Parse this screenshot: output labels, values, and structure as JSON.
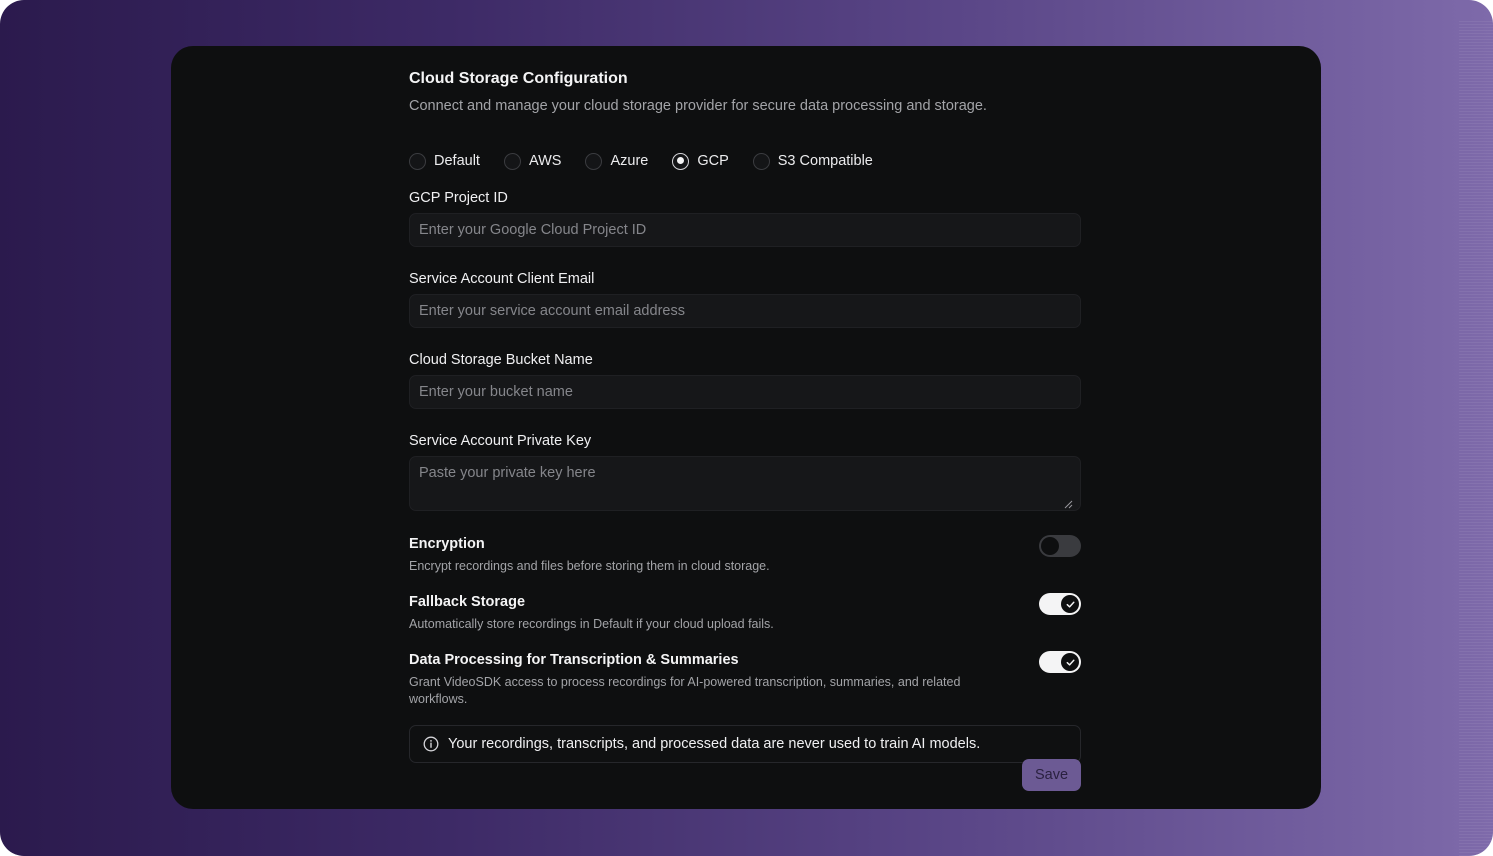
{
  "header": {
    "title": "Cloud Storage Configuration",
    "subtitle": "Connect and manage your cloud storage provider for secure data processing and storage."
  },
  "providers": {
    "selected": "GCP",
    "options": [
      {
        "label": "Default",
        "checked": false
      },
      {
        "label": "AWS",
        "checked": false
      },
      {
        "label": "Azure",
        "checked": false
      },
      {
        "label": "GCP",
        "checked": true
      },
      {
        "label": "S3 Compatible",
        "checked": false
      }
    ]
  },
  "fields": {
    "project_id": {
      "label": "GCP Project ID",
      "placeholder": "Enter your Google Cloud Project ID",
      "value": ""
    },
    "client_email": {
      "label": "Service Account Client Email",
      "placeholder": "Enter your service account email address",
      "value": ""
    },
    "bucket_name": {
      "label": "Cloud Storage Bucket Name",
      "placeholder": "Enter your bucket name",
      "value": ""
    },
    "private_key": {
      "label": "Service Account Private Key",
      "placeholder": "Paste your private key here",
      "value": ""
    }
  },
  "settings": {
    "encryption": {
      "title": "Encryption",
      "description": "Encrypt recordings and files before storing them in cloud storage.",
      "enabled": false
    },
    "fallback": {
      "title": "Fallback Storage",
      "description": "Automatically store recordings in Default if your cloud upload fails.",
      "enabled": true
    },
    "data_processing": {
      "title": "Data Processing for Transcription & Summaries",
      "description": "Grant VideoSDK access to process recordings for AI-powered transcription, summaries, and related workflows.",
      "enabled": true
    }
  },
  "notice": {
    "icon": "info-icon",
    "text": "Your recordings, transcripts, and processed data are never used to train AI models."
  },
  "actions": {
    "save_label": "Save"
  },
  "colors": {
    "accent": "#6c5a94",
    "card_bg": "#0e0f10",
    "input_bg": "#161719"
  }
}
